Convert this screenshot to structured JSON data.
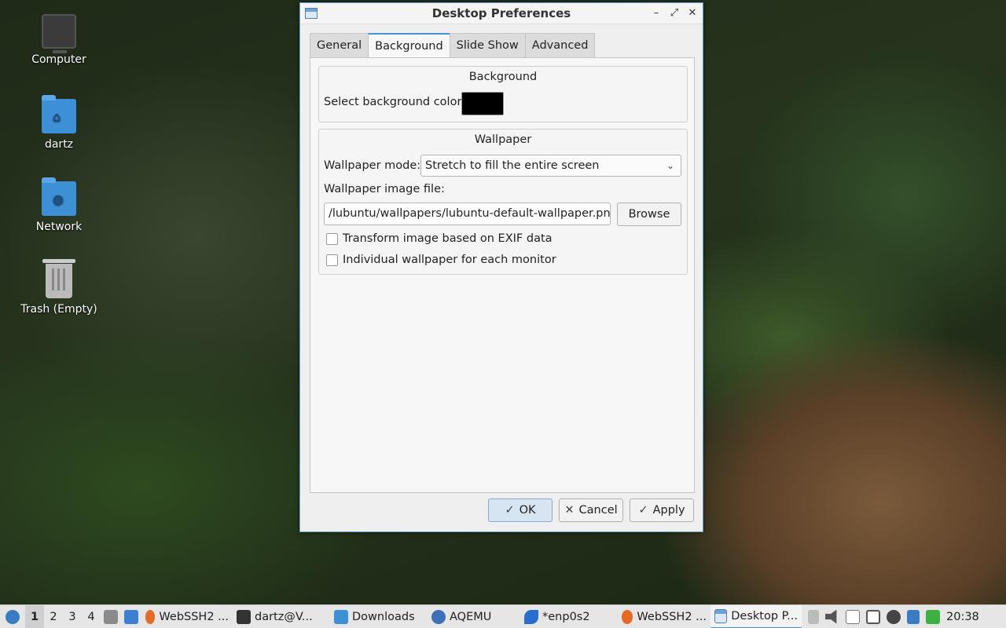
{
  "desktop": {
    "icons": [
      {
        "label": "Computer",
        "icon": "computer-icon"
      },
      {
        "label": "dartz",
        "icon": "home-folder-icon"
      },
      {
        "label": "Network",
        "icon": "network-folder-icon"
      },
      {
        "label": "Trash (Empty)",
        "icon": "trash-icon"
      }
    ]
  },
  "dialog": {
    "title": "Desktop Preferences",
    "tabs": [
      "General",
      "Background",
      "Slide Show",
      "Advanced"
    ],
    "active_tab": "Background",
    "background_group": {
      "title": "Background",
      "color_label": "Select background color:",
      "color_value": "#000000"
    },
    "wallpaper_group": {
      "title": "Wallpaper",
      "mode_label": "Wallpaper mode:",
      "mode_value": "Stretch to fill the entire screen",
      "file_label": "Wallpaper image file:",
      "file_value": "/lubuntu/wallpapers/lubuntu-default-wallpaper.png",
      "browse_label": "Browse",
      "exif_label": "Transform image based on EXIF data",
      "per_monitor_label": "Individual wallpaper for each monitor"
    },
    "buttons": {
      "ok": "OK",
      "cancel": "Cancel",
      "apply": "Apply"
    }
  },
  "taskbar": {
    "workspaces": [
      "1",
      "2",
      "3",
      "4"
    ],
    "tasks": [
      {
        "label": "WebSSH2 ...",
        "icon": "firefox-icon"
      },
      {
        "label": "dartz@V...",
        "icon": "terminal-icon"
      },
      {
        "label": "Downloads",
        "icon": "folder-icon"
      },
      {
        "label": "AQEMU",
        "icon": "aqemu-icon"
      },
      {
        "label": "*enp0s2",
        "icon": "wireshark-icon"
      },
      {
        "label": "WebSSH2 ...",
        "icon": "firefox-icon"
      },
      {
        "label": "Desktop P...",
        "icon": "desktop-prefs-icon"
      }
    ],
    "clock": "20:38"
  }
}
